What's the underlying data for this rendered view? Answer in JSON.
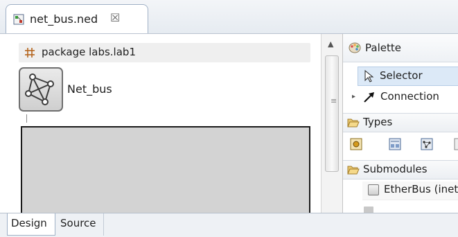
{
  "editor": {
    "tab_title": "net_bus.ned",
    "tab_close_symbol": "☒"
  },
  "canvas": {
    "package_label": "package labs.lab1",
    "network_label": "Net_bus"
  },
  "palette": {
    "title": "Palette",
    "tools": [
      {
        "label": "Selector",
        "icon": "selector-arrow-icon",
        "selected": true
      },
      {
        "label": "Connection",
        "icon": "connection-arrow-icon",
        "selected": false
      }
    ],
    "drawers": {
      "types": "Types",
      "submodules": "Submodules"
    },
    "submodules": [
      {
        "label": "EtherBus (inet"
      }
    ]
  },
  "bottom_tabs": [
    {
      "label": "Design",
      "active": true
    },
    {
      "label": "Source",
      "active": false
    }
  ],
  "colors": {
    "selected_tool_bg": "#dce9f7",
    "module_box_fill": "#d3d3d3"
  }
}
